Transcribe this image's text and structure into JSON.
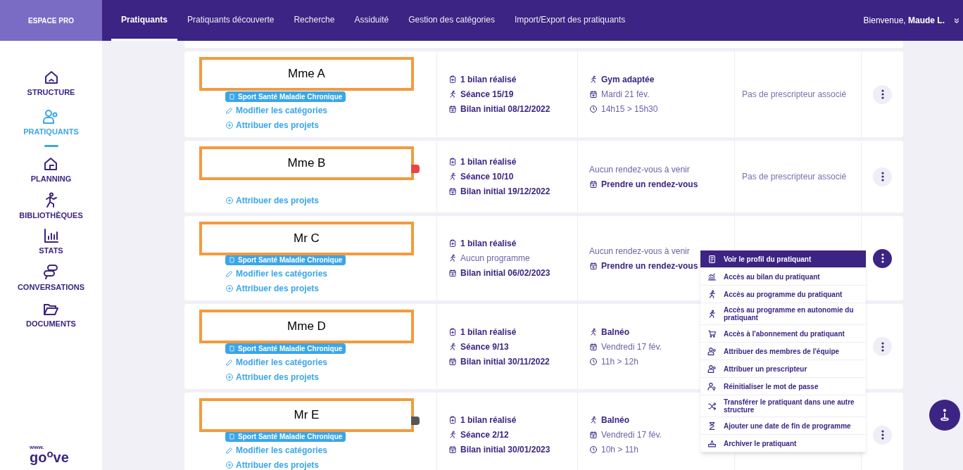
{
  "topbar": {
    "brand": "ESPACE PRO",
    "tabs": [
      {
        "label": "Pratiquants",
        "selected": true
      },
      {
        "label": "Pratiquants découverte",
        "selected": false
      },
      {
        "label": "Recherche",
        "selected": false
      },
      {
        "label": "Assiduité",
        "selected": false
      },
      {
        "label": "Gestion des catégories",
        "selected": false
      },
      {
        "label": "Import/Export des pratiquants",
        "selected": false
      }
    ],
    "welcome": "Bienvenue, **Maude L.**",
    "toggle": "»"
  },
  "sidebar": {
    "items": [
      {
        "kind": "structure",
        "label": "STRUCTURE",
        "selected": false
      },
      {
        "kind": "people",
        "label": "PRATIQUANTS",
        "selected": true
      },
      {
        "kind": "planning",
        "label": "PLANNING",
        "selected": false
      },
      {
        "kind": "library",
        "label": "BIBLIOTHÈQUES",
        "selected": false
      },
      {
        "kind": "stats",
        "label": "STATS",
        "selected": false
      },
      {
        "kind": "chat",
        "label": "CONVERSATIONS",
        "selected": false
      },
      {
        "kind": "folder",
        "label": "DOCUMENTS",
        "selected": false
      }
    ],
    "logo_prefix": "www.",
    "logo": "go$^{o}$ve"
  },
  "rows": [
    {
      "name": "Mme A",
      "tag": "Sport Santé Maladie Chronique",
      "modify": "Modifier les catégories",
      "assign": "Attribuer des projets",
      "stats": [
        {
          "kind": "report",
          "text": "1 bilan réalisé",
          "strong": true
        },
        {
          "kind": "run",
          "text": "Séance 15/19",
          "strong": true
        },
        {
          "kind": "date",
          "text": "Bilan initial 08/12/2022",
          "strong": true
        }
      ],
      "appointment": [
        {
          "kind": "run",
          "text": "Gym adaptée",
          "strong": true
        },
        {
          "kind": "date",
          "text": "Mardi 21 fév.",
          "strong": false
        },
        {
          "kind": "clock",
          "text": "14h15 > 15h30",
          "strong": false
        }
      ],
      "prescriber": "Pas de prescripteur associé",
      "menu_open": false
    },
    {
      "name": "Mme B",
      "color": "#e84545",
      "assign": "Attribuer des projets",
      "stats": [
        {
          "kind": "report",
          "text": "1 bilan réalisé",
          "strong": true
        },
        {
          "kind": "run",
          "text": "Séance 10/10",
          "strong": true
        },
        {
          "kind": "date",
          "text": "Bilan initial 19/12/2022",
          "strong": true
        }
      ],
      "appointment": [
        {
          "kind": "note",
          "text": "Aucun rendez-vous à venir",
          "strong": false
        },
        {
          "kind": "date",
          "text": "Prendre un rendez-vous",
          "strong": true
        }
      ],
      "prescriber": "Pas de prescripteur associé",
      "menu_open": false
    },
    {
      "name": "Mr C",
      "tag": "Sport Santé Maladie Chronique",
      "modify": "Modifier les catégories",
      "assign": "Attribuer des projets",
      "stats": [
        {
          "kind": "report",
          "text": "1 bilan réalisé",
          "strong": true
        },
        {
          "kind": "run",
          "text": "Aucun programme",
          "strong": false
        },
        {
          "kind": "date",
          "text": "Bilan initial 06/02/2023",
          "strong": true
        }
      ],
      "appointment": [
        {
          "kind": "note",
          "text": "Aucun rendez-vous à venir",
          "strong": false
        },
        {
          "kind": "date",
          "text": "Prendre un rendez-vous",
          "strong": true
        }
      ],
      "menu_open": true
    },
    {
      "name": "Mme D",
      "tag": "Sport Santé Maladie Chronique",
      "modify": "Modifier les catégories",
      "assign": "Attribuer des projets",
      "stats": [
        {
          "kind": "report",
          "text": "1 bilan réalisé",
          "strong": true
        },
        {
          "kind": "run",
          "text": "Séance 9/13",
          "strong": true
        },
        {
          "kind": "date",
          "text": "Bilan initial 30/11/2022",
          "strong": true
        }
      ],
      "appointment": [
        {
          "kind": "run",
          "text": "Balnéo",
          "strong": true
        },
        {
          "kind": "date",
          "text": "Vendredi 17 fév.",
          "strong": false
        },
        {
          "kind": "clock",
          "text": "11h > 12h",
          "strong": false
        }
      ],
      "menu_open": false
    },
    {
      "name": "Mr E",
      "color": "#555555",
      "tag": "Sport Santé Maladie Chronique",
      "modify": "Modifier les catégories",
      "assign": "Attribuer des projets",
      "stats": [
        {
          "kind": "report",
          "text": "1 bilan réalisé",
          "strong": true
        },
        {
          "kind": "run",
          "text": "Séance 2/12",
          "strong": true
        },
        {
          "kind": "date",
          "text": "Bilan initial 30/01/2023",
          "strong": true
        }
      ],
      "appointment": [
        {
          "kind": "run",
          "text": "Balnéo",
          "strong": true
        },
        {
          "kind": "date",
          "text": "Vendredi 17 fév.",
          "strong": false
        },
        {
          "kind": "clock",
          "text": "10h > 11h",
          "strong": false
        }
      ],
      "menu_open": false
    }
  ],
  "menu": {
    "items": [
      {
        "label": "Voir le profil du pratiquant",
        "selected": true
      },
      {
        "label": "Accès au bilan du pratiquant",
        "selected": false
      },
      {
        "label": "Accès au programme du pratiquant",
        "selected": false
      },
      {
        "label": "Accès au programme en autonomie du pratiquant",
        "selected": false
      },
      {
        "label": "Accès à l'abonnement du pratiquant",
        "selected": false
      },
      {
        "label": "Attribuer des membres de l'équipe",
        "selected": false
      },
      {
        "label": "Attribuer un prescripteur",
        "selected": false
      },
      {
        "label": "Réinitialiser le mot de passe",
        "selected": false
      },
      {
        "label": "Transférer le pratiquant dans une autre structure",
        "selected": false
      },
      {
        "label": "Ajouter une date de fin de programme",
        "selected": false
      },
      {
        "label": "Archiver le pratiquant",
        "selected": false
      }
    ]
  }
}
